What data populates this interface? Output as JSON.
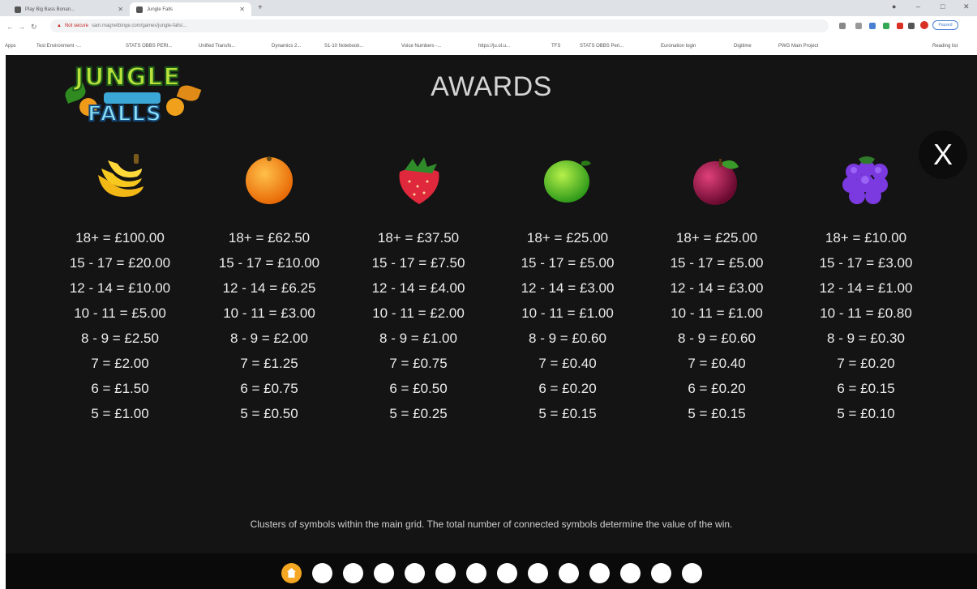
{
  "browser": {
    "tabs": [
      {
        "label": "Play Big Bass Bonan..."
      },
      {
        "label": "Jungle Falls"
      }
    ],
    "new_tab": "+",
    "address": {
      "security": "Not secure",
      "url": "sam.magnetbinge.com/games/jungle-falls/..."
    },
    "bookmarks": [
      "Apps",
      "Test Environment -...",
      "STATS OBBS PERI...",
      "Unified Transfo...",
      "Dynamics 2...",
      "S1-10 Notebook...",
      "Voice Numbers -...",
      "https://ju.ol.u...",
      "TFS",
      "STATS OBBS Peri...",
      "Euronation login",
      "Digitime",
      "PWG Main Project",
      "Reading list"
    ],
    "profile_label": "Paused"
  },
  "game": {
    "logo": {
      "line1": "JUNGLE",
      "line2": "FALLS"
    },
    "title": "AWARDS",
    "close_label": "X",
    "description": "Clusters of symbols within the main grid. The total number of connected symbols determine the value of the win.",
    "pages": 14,
    "active_page": 1,
    "symbols": [
      {
        "icon": "banana-icon",
        "payouts": [
          "18+ = £100.00",
          "15 - 17 = £20.00",
          "12 - 14 = £10.00",
          "10 - 11 = £5.00",
          "8 - 9 = £2.50",
          "7 = £2.00",
          "6 = £1.50",
          "5 = £1.00"
        ]
      },
      {
        "icon": "orange-icon",
        "payouts": [
          "18+ = £62.50",
          "15 - 17 = £10.00",
          "12 - 14 = £6.25",
          "10 - 11 = £3.00",
          "8 - 9 = £2.00",
          "7 = £1.25",
          "6 = £0.75",
          "5 = £0.50"
        ]
      },
      {
        "icon": "strawberry-icon",
        "payouts": [
          "18+ = £37.50",
          "15 - 17 = £7.50",
          "12 - 14 = £4.00",
          "10 - 11 = £2.00",
          "8 - 9 = £1.00",
          "7 = £0.75",
          "6 = £0.50",
          "5 = £0.25"
        ]
      },
      {
        "icon": "lime-icon",
        "payouts": [
          "18+ = £25.00",
          "15 - 17 = £5.00",
          "12 - 14 = £3.00",
          "10 - 11 = £1.00",
          "8 - 9 = £0.60",
          "7 = £0.40",
          "6 = £0.20",
          "5 = £0.15"
        ]
      },
      {
        "icon": "plum-icon",
        "payouts": [
          "18+ = £25.00",
          "15 - 17 = £5.00",
          "12 - 14 = £3.00",
          "10 - 11 = £1.00",
          "8 - 9 = £0.60",
          "7 = £0.40",
          "6 = £0.20",
          "5 = £0.15"
        ]
      },
      {
        "icon": "grapes-icon",
        "payouts": [
          "18+ = £10.00",
          "15 - 17 = £3.00",
          "12 - 14 = £1.00",
          "10 - 11 = £0.80",
          "8 - 9 = £0.30",
          "7 = £0.20",
          "6 = £0.15",
          "5 = £0.10"
        ]
      }
    ],
    "colors": {
      "background": "#141414",
      "footer": "#0a0a0a",
      "active_dot": "#f5a623",
      "text": "#ececec"
    }
  }
}
